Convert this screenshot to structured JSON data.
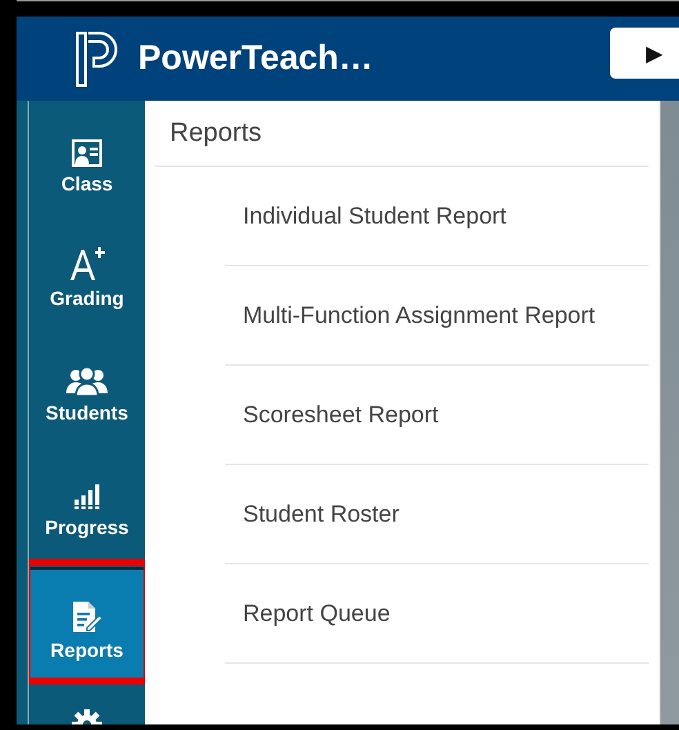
{
  "header": {
    "title": "PowerTeach…",
    "button": "▶"
  },
  "sidebar": {
    "items": [
      {
        "label": "Class",
        "selected": false
      },
      {
        "label": "Grading",
        "selected": false
      },
      {
        "label": "Students",
        "selected": false
      },
      {
        "label": "Progress",
        "selected": false
      },
      {
        "label": "Reports",
        "selected": true,
        "highlighted": true
      },
      {
        "selected": false
      }
    ]
  },
  "panel": {
    "title": "Reports",
    "items": [
      "Individual Student Report",
      "Multi-Function Assignment Report",
      "Scoresheet Report",
      "Student Roster",
      "Report Queue"
    ]
  }
}
